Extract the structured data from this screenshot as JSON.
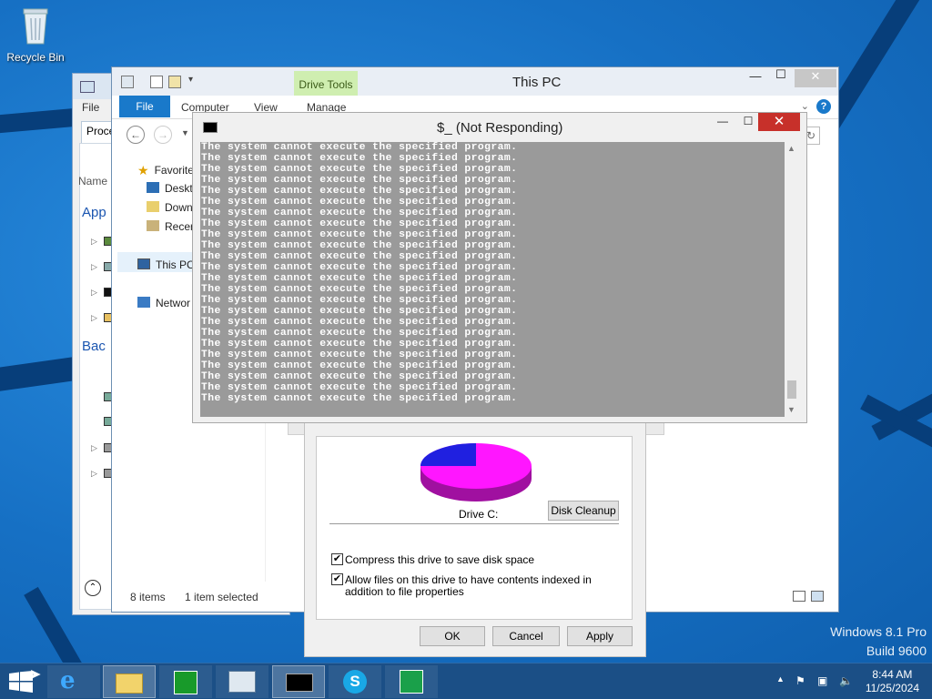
{
  "desktop": {
    "recycle_bin_label": "Recycle Bin",
    "os_name": "Windows 8.1 Pro",
    "build": "Build 9600"
  },
  "task_manager": {
    "menu_file": "File",
    "tab_processes": "Proce",
    "col_name": "Name",
    "section_apps": "App",
    "section_background": "Bac"
  },
  "explorer": {
    "title": "This PC",
    "contextual_tab": "Drive Tools",
    "ribbon_tabs": [
      "File",
      "Computer",
      "View",
      "Manage"
    ],
    "nav_items": {
      "favorites": "Favorite",
      "desktop": "Deskt",
      "downloads": "Down",
      "recent": "Recer",
      "this_pc": "This PC",
      "network": "Networ"
    },
    "status_items": "8 items",
    "status_selected": "1 item selected"
  },
  "console": {
    "title": "$_ (Not Responding)",
    "lines": [
      "The system cannot execute the specified program.",
      "The system cannot execute the specified program.",
      "The system cannot execute the specified program.",
      "The system cannot execute the specified program.",
      "The system cannot execute the specified program.",
      "The system cannot execute the specified program.",
      "The system cannot execute the specified program.",
      "The system cannot execute the specified program.",
      "The system cannot execute the specified program.",
      "The system cannot execute the specified program.",
      "The system cannot execute the specified program.",
      "The system cannot execute the specified program.",
      "The system cannot execute the specified program.",
      "The system cannot execute the specified program.",
      "The system cannot execute the specified program.",
      "The system cannot execute the specified program.",
      "The system cannot execute the specified program.",
      "The system cannot execute the specified program.",
      "The system cannot execute the specified program.",
      "The system cannot execute the specified program.",
      "The system cannot execute the specified program.",
      "The system cannot execute the specified program.",
      "The system cannot execute the specified program.",
      "The system cannot execute the specified program."
    ]
  },
  "properties": {
    "drive_label": "Drive C:",
    "disk_cleanup": "Disk Cleanup",
    "compress_label": "Compress this drive to save disk space",
    "compress_checked": true,
    "index_label": "Allow files on this drive to have contents indexed in addition to file properties",
    "index_checked": true,
    "ok": "OK",
    "cancel": "Cancel",
    "apply": "Apply",
    "pie_used_color": "#2020e0",
    "pie_free_color": "#ff16ff"
  },
  "taskbar": {
    "apps": [
      "start-icon",
      "internet-explorer-icon",
      "file-explorer-icon",
      "store-icon",
      "task-manager-icon",
      "command-prompt-icon",
      "skype-icon",
      "finance-icon"
    ],
    "time": "8:44 AM",
    "date": "11/25/2024"
  }
}
